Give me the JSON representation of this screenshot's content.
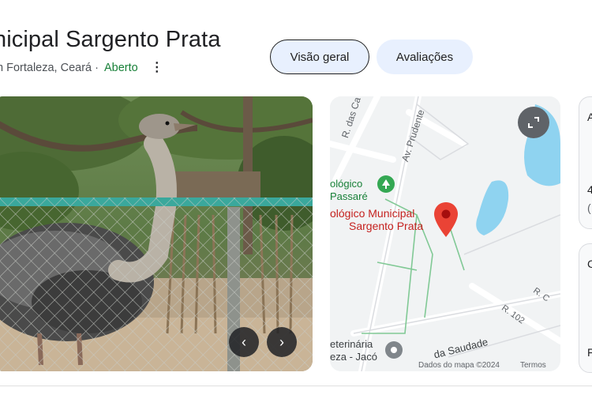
{
  "place": {
    "title": "nicipal Sargento Prata",
    "location": "m Fortaleza, Ceará",
    "separator": "·",
    "status": "Aberto",
    "more_icon": "more-vert-icon"
  },
  "tabs": {
    "overview": "Visão geral",
    "reviews": "Avaliações"
  },
  "map": {
    "street_1": "R. das Ca",
    "street_2": "Av. Prudente",
    "poi_label_1": "ológico",
    "poi_label_2": "Passaré",
    "place_label_1": "ológico Municipal",
    "place_label_2": "Sargento Prata",
    "street_3": "R. 102",
    "street_4": "R. C",
    "street_5": "da Saudade",
    "vet_label_1": "eterinária",
    "vet_label_2": "eza - Jacó",
    "attribution": "Dados do mapa ©2024",
    "terms": "Termos",
    "marker_color": "#ea4335"
  },
  "side": {
    "a": "A",
    "four": "4",
    "paren": "(",
    "c": "C",
    "f": "F"
  }
}
